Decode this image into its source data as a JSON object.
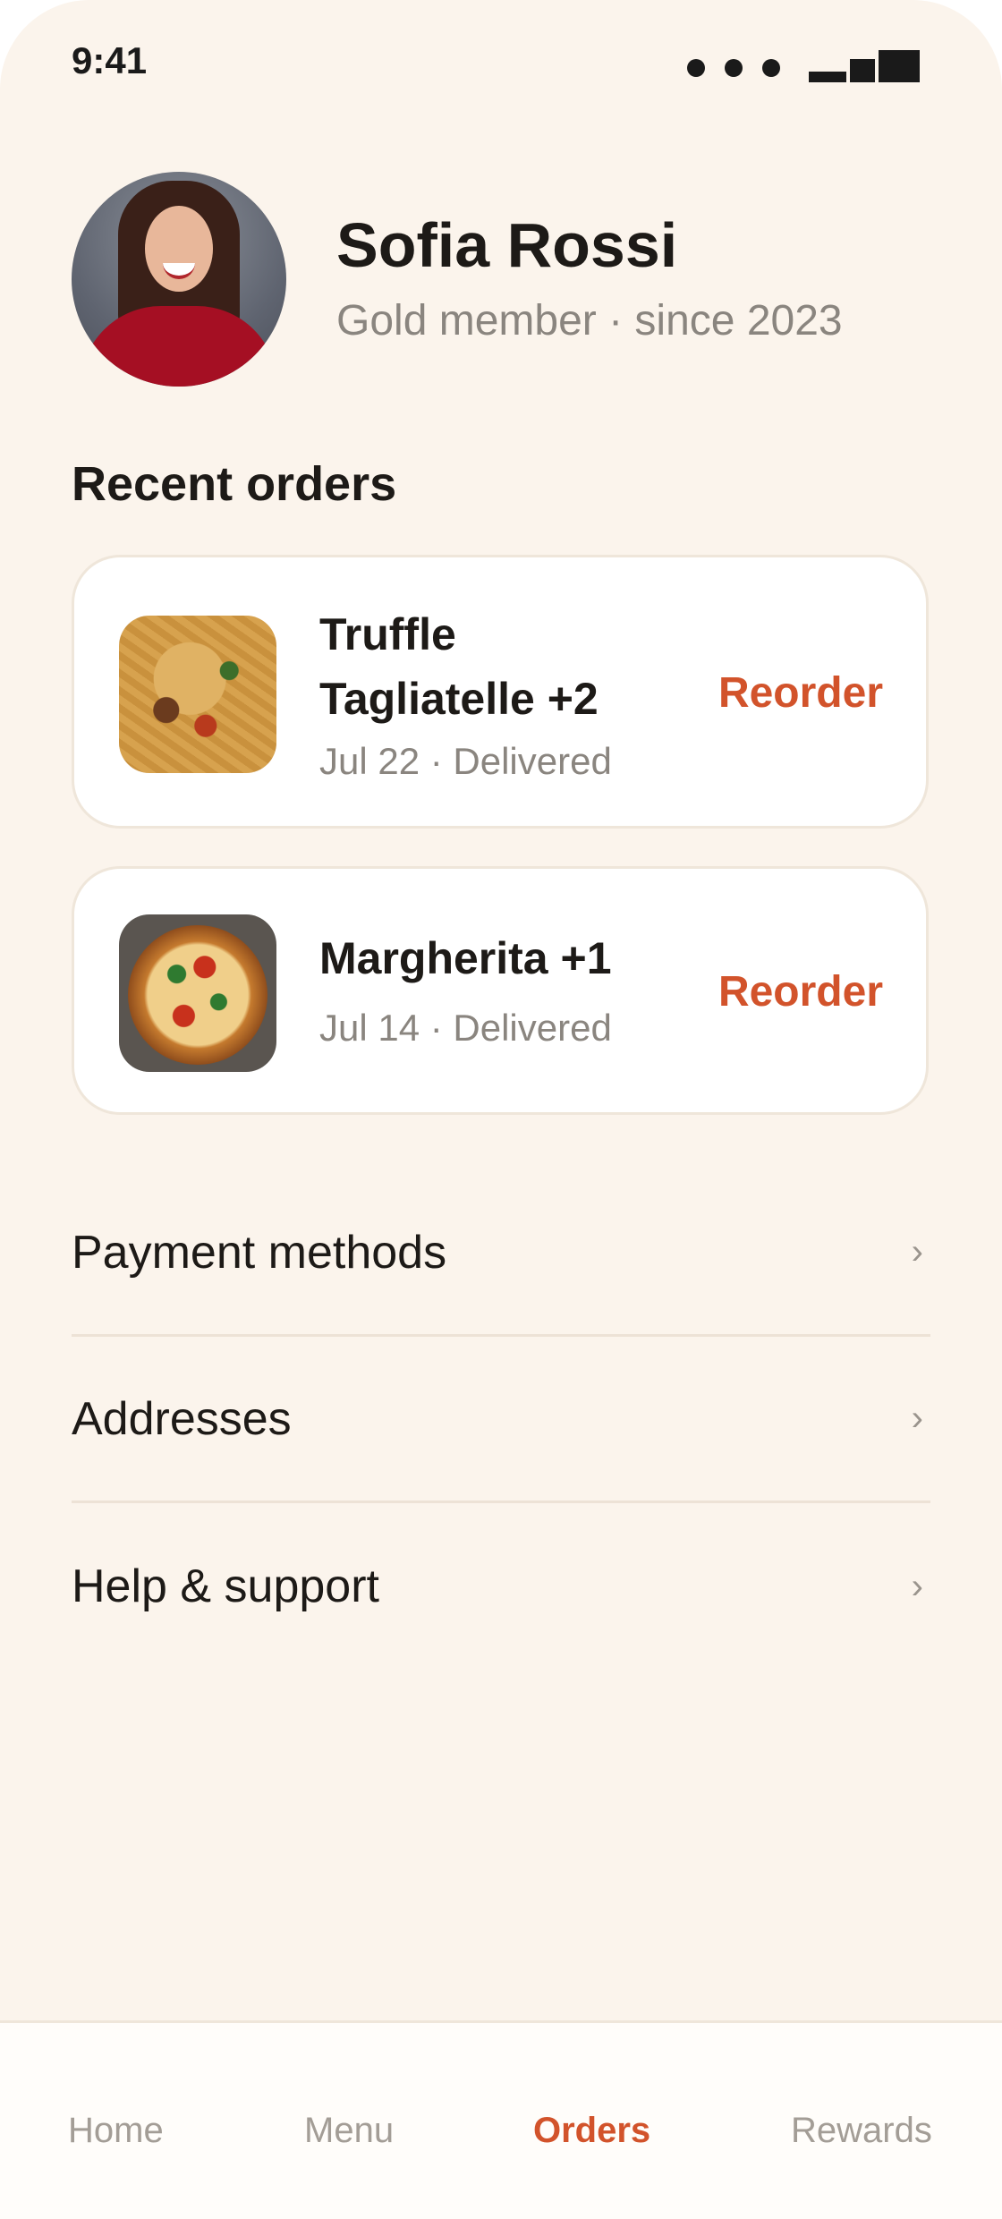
{
  "status_bar": {
    "time": "9:41"
  },
  "profile": {
    "name": "Sofia Rossi",
    "subtitle": "Gold member · since 2023"
  },
  "recent_orders": {
    "title": "Recent orders",
    "orders": [
      {
        "title": "Truffle Tagliatelle +2",
        "meta": "Jul 22 · Delivered",
        "action": "Reorder"
      },
      {
        "title": "Margherita +1",
        "meta": "Jul 14 · Delivered",
        "action": "Reorder"
      }
    ]
  },
  "menu": [
    {
      "label": "Payment methods",
      "icon": "chevron-right-icon"
    },
    {
      "label": "Addresses",
      "icon": "chevron-right-icon"
    },
    {
      "label": "Help & support",
      "icon": "chevron-right-icon"
    }
  ],
  "tabs": [
    {
      "label": "Home",
      "active": false
    },
    {
      "label": "Menu",
      "active": false
    },
    {
      "label": "Orders",
      "active": true
    },
    {
      "label": "Rewards",
      "active": false
    }
  ],
  "colors": {
    "background": "#FBF4EC",
    "accent": "#D2532B",
    "text_primary": "#1D1A17",
    "text_secondary": "#8A857F"
  }
}
